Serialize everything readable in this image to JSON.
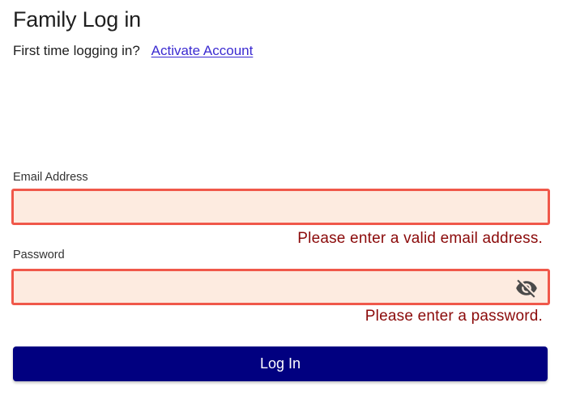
{
  "page": {
    "title": "Family Log in",
    "first_time_prompt": "First time logging in?",
    "activate_link": "Activate Account"
  },
  "form": {
    "email": {
      "label": "Email Address",
      "value": "",
      "error": "Please enter a valid email address."
    },
    "password": {
      "label": "Password",
      "value": "",
      "error": "Please enter a password.",
      "toggle_icon": "eye-off-icon"
    },
    "submit_label": "Log In"
  },
  "colors": {
    "error_border": "#f0584a",
    "error_fill": "#fdebe0",
    "error_text": "#8b0a0a",
    "link": "#3b2bd1",
    "button": "#010080"
  }
}
